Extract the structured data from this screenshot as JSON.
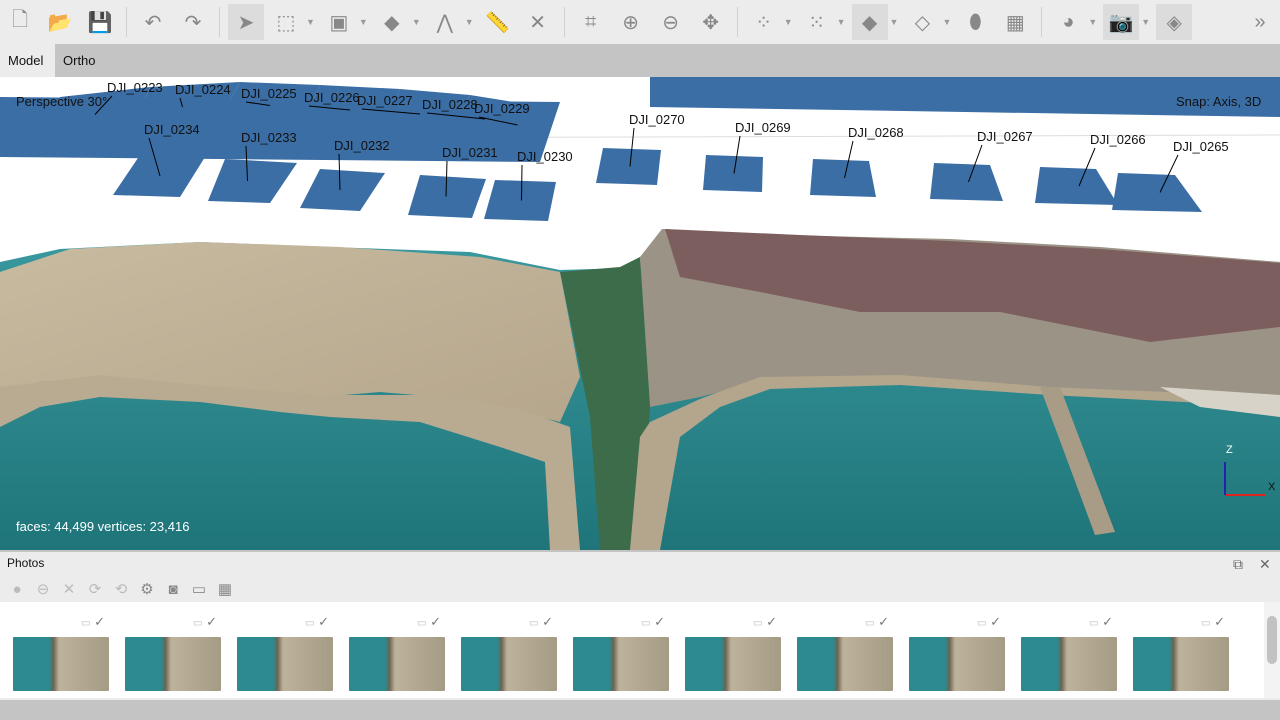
{
  "toolbar": {
    "items": [
      {
        "name": "new-document-icon",
        "glyph": "🗋"
      },
      {
        "name": "open-folder-icon",
        "glyph": "📂"
      },
      {
        "name": "save-icon",
        "glyph": "💾"
      },
      {
        "name": "undo-icon",
        "glyph": "↶"
      },
      {
        "name": "redo-icon",
        "glyph": "↷"
      },
      {
        "name": "navigation-cursor-icon",
        "glyph": "➤"
      },
      {
        "name": "rectangle-selection-icon",
        "glyph": "⬚"
      },
      {
        "name": "move-object-icon",
        "glyph": "▣"
      },
      {
        "name": "rotate-object-icon",
        "glyph": "◆"
      },
      {
        "name": "measure-angle-icon",
        "glyph": "⋀"
      },
      {
        "name": "ruler-icon",
        "glyph": "📏"
      },
      {
        "name": "delete-selection-icon",
        "glyph": "✕"
      },
      {
        "name": "crop-icon",
        "glyph": "⌗"
      },
      {
        "name": "zoom-in-icon",
        "glyph": "⊕"
      },
      {
        "name": "zoom-out-icon",
        "glyph": "⊖"
      },
      {
        "name": "reset-view-icon",
        "glyph": "✥"
      },
      {
        "name": "point-cloud-icon",
        "glyph": "⁘"
      },
      {
        "name": "dense-cloud-icon",
        "glyph": "⁙"
      },
      {
        "name": "model-solid-icon",
        "glyph": "◆"
      },
      {
        "name": "model-wireframe-icon",
        "glyph": "◇"
      },
      {
        "name": "dem-icon",
        "glyph": "⬮"
      },
      {
        "name": "orthomosaic-icon",
        "glyph": "▦"
      },
      {
        "name": "globe-icon",
        "glyph": "◕"
      },
      {
        "name": "camera-icon",
        "glyph": "📷"
      },
      {
        "name": "shapes-icon",
        "glyph": "◈"
      }
    ],
    "overflow": "»"
  },
  "tabs": [
    {
      "label": "Model",
      "active": true
    },
    {
      "label": "Ortho",
      "active": false
    }
  ],
  "viewport": {
    "projection": "Perspective 30°",
    "snap": "Snap: Axis, 3D",
    "stats": "faces: 44,499 vertices: 23,416",
    "axes": {
      "x": "X",
      "z": "Z"
    },
    "camera_color": "#3b6ea5",
    "cameras": [
      "DJI_0223",
      "DJI_0224",
      "DJI_0225",
      "DJI_0226",
      "DJI_0227",
      "DJI_0228",
      "DJI_0229",
      "DJI_0234",
      "DJI_0233",
      "DJI_0232",
      "DJI_0231",
      "DJI_0230",
      "DJI_0270",
      "DJI_0269",
      "DJI_0268",
      "DJI_0267",
      "DJI_0266",
      "DJI_0265"
    ]
  },
  "photos_panel": {
    "title": "Photos",
    "tools": [
      {
        "name": "enable-camera-icon",
        "glyph": "●"
      },
      {
        "name": "disable-camera-icon",
        "glyph": "⊖"
      },
      {
        "name": "remove-camera-icon",
        "glyph": "✕"
      },
      {
        "name": "rotate-right-icon",
        "glyph": "⟳"
      },
      {
        "name": "rotate-left-icon",
        "glyph": "⟲"
      },
      {
        "name": "calibration-icon",
        "glyph": "⚙"
      },
      {
        "name": "mask-icon",
        "glyph": "◙"
      },
      {
        "name": "overlay-icon",
        "glyph": "▭"
      },
      {
        "name": "grid-view-icon",
        "glyph": "▦"
      }
    ],
    "restore_button": "⧉",
    "close_button": "✕",
    "thumbnail_count": 11,
    "thumbnail_status": "✓"
  }
}
